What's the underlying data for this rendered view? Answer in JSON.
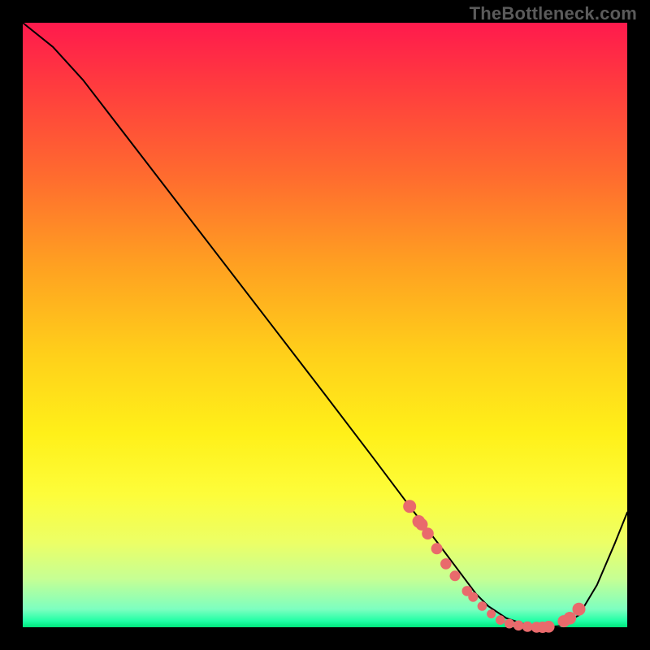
{
  "watermark": "TheBottleneck.com",
  "chart_data": {
    "type": "line",
    "title": "",
    "xlabel": "",
    "ylabel": "",
    "xlim": [
      0,
      1
    ],
    "ylim": [
      0,
      1
    ],
    "series": [
      {
        "name": "curve",
        "x": [
          0.0,
          0.05,
          0.1,
          0.2,
          0.3,
          0.4,
          0.5,
          0.58,
          0.64,
          0.69,
          0.72,
          0.75,
          0.77,
          0.8,
          0.83,
          0.86,
          0.89,
          0.92,
          0.95,
          0.98,
          1.0
        ],
        "y": [
          1.0,
          0.96,
          0.905,
          0.775,
          0.645,
          0.515,
          0.385,
          0.28,
          0.2,
          0.135,
          0.095,
          0.055,
          0.035,
          0.015,
          0.005,
          0.0,
          0.002,
          0.02,
          0.07,
          0.14,
          0.19
        ]
      },
      {
        "name": "highlight-dots",
        "x": [
          0.64,
          0.655,
          0.66,
          0.67,
          0.685,
          0.7,
          0.715,
          0.735,
          0.745,
          0.76,
          0.775,
          0.79,
          0.805,
          0.82,
          0.835,
          0.85,
          0.86,
          0.87,
          0.895,
          0.905,
          0.92
        ],
        "y": [
          0.2,
          0.175,
          0.17,
          0.155,
          0.13,
          0.105,
          0.085,
          0.06,
          0.05,
          0.035,
          0.022,
          0.012,
          0.006,
          0.003,
          0.001,
          0.0,
          0.0,
          0.001,
          0.01,
          0.015,
          0.03
        ]
      }
    ],
    "gradient_stops": [
      {
        "pos": 0.0,
        "color": "#ff1a4d"
      },
      {
        "pos": 0.1,
        "color": "#ff3a3f"
      },
      {
        "pos": 0.25,
        "color": "#ff6a2f"
      },
      {
        "pos": 0.4,
        "color": "#ffa021"
      },
      {
        "pos": 0.55,
        "color": "#ffd01a"
      },
      {
        "pos": 0.68,
        "color": "#fff019"
      },
      {
        "pos": 0.78,
        "color": "#fdfd3a"
      },
      {
        "pos": 0.86,
        "color": "#ecff66"
      },
      {
        "pos": 0.92,
        "color": "#c6ff94"
      },
      {
        "pos": 0.97,
        "color": "#7dffc0"
      },
      {
        "pos": 0.99,
        "color": "#1fffa5"
      },
      {
        "pos": 1.0,
        "color": "#00e57c"
      }
    ],
    "dot_color": "#e96a6c"
  }
}
